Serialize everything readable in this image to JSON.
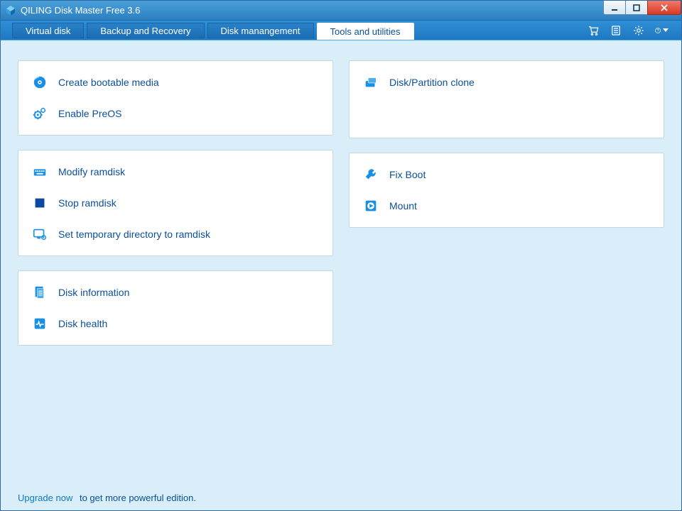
{
  "title": "QILING Disk Master Free 3.6",
  "tabs": [
    {
      "label": "Virtual disk",
      "active": false
    },
    {
      "label": "Backup and Recovery",
      "active": false
    },
    {
      "label": "Disk manangement",
      "active": false
    },
    {
      "label": "Tools and utilities",
      "active": true
    }
  ],
  "topbar_icons": {
    "cart": "cart-icon",
    "list": "list-icon",
    "settings": "gear-icon",
    "help": "help-icon"
  },
  "cards": {
    "left": [
      {
        "items": [
          {
            "name": "create-bootable-media",
            "label": "Create bootable media",
            "icon": "disc-icon"
          },
          {
            "name": "enable-preos",
            "label": "Enable PreOS",
            "icon": "gears-icon"
          }
        ]
      },
      {
        "items": [
          {
            "name": "modify-ramdisk",
            "label": "Modify ramdisk",
            "icon": "keyboard-icon"
          },
          {
            "name": "stop-ramdisk",
            "label": "Stop ramdisk",
            "icon": "stop-icon"
          },
          {
            "name": "set-temp-dir-ramdisk",
            "label": "Set temporary directory to ramdisk",
            "icon": "monitor-gear-icon"
          }
        ]
      },
      {
        "items": [
          {
            "name": "disk-information",
            "label": "Disk information",
            "icon": "document-icon"
          },
          {
            "name": "disk-health",
            "label": "Disk health",
            "icon": "heartbeat-icon"
          }
        ]
      }
    ],
    "right": [
      {
        "items": [
          {
            "name": "disk-partition-clone",
            "label": "Disk/Partition clone",
            "icon": "clone-icon"
          }
        ],
        "min_height": 110
      },
      {
        "items": [
          {
            "name": "fix-boot",
            "label": "Fix Boot",
            "icon": "wrench-icon"
          },
          {
            "name": "mount",
            "label": "Mount",
            "icon": "play-icon"
          }
        ]
      }
    ]
  },
  "footer": {
    "link": "Upgrade now",
    "rest": "to get more powerful edition."
  }
}
